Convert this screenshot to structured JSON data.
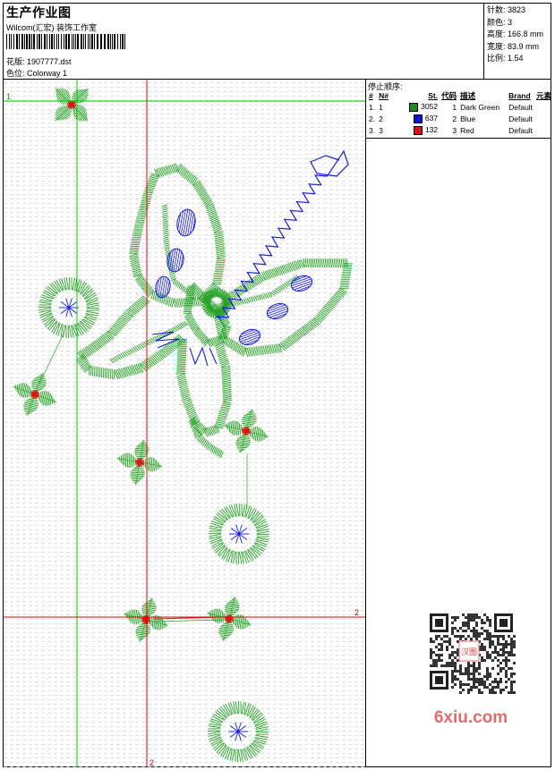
{
  "header": {
    "title": "生产作业图",
    "subtitle": "Wilcom(汇宏) 装饰工作室",
    "pattern_label": "花版: 1907777.dst",
    "colorway_label": "色位: Colorway 1"
  },
  "stats": [
    {
      "label": "针数:",
      "value": "3823"
    },
    {
      "label": "颜色:",
      "value": "3"
    },
    {
      "label": "高度:",
      "value": "166.8 mm"
    },
    {
      "label": "宽度:",
      "value": "83.9 mm"
    },
    {
      "label": "比例:",
      "value": "1.54"
    }
  ],
  "stop_sequence": {
    "title": "停止顺序:",
    "columns": [
      "#",
      "N#",
      "St.",
      "代码",
      "描述",
      "Brand",
      "元素"
    ],
    "rows": [
      {
        "idx": "1.",
        "n": "1",
        "color": "#1a8a1a",
        "st": "3052",
        "code": "1",
        "desc": "Dark Green",
        "brand": "Default"
      },
      {
        "idx": "2.",
        "n": "2",
        "color": "#1010e0",
        "st": "637",
        "code": "2",
        "desc": "Blue",
        "brand": "Default"
      },
      {
        "idx": "3.",
        "n": "3",
        "color": "#e01010",
        "st": "132",
        "code": "3",
        "desc": "Red",
        "brand": "Default"
      }
    ]
  },
  "guides": {
    "green_label": "1",
    "red_label": "2"
  },
  "watermark": {
    "text": "6xiu.com",
    "badge": "汉图"
  },
  "colors": {
    "green": "#22a022",
    "blue": "#1a1ae0",
    "red": "#e01010",
    "guide_green": "#00c800",
    "guide_red": "#e00000"
  }
}
